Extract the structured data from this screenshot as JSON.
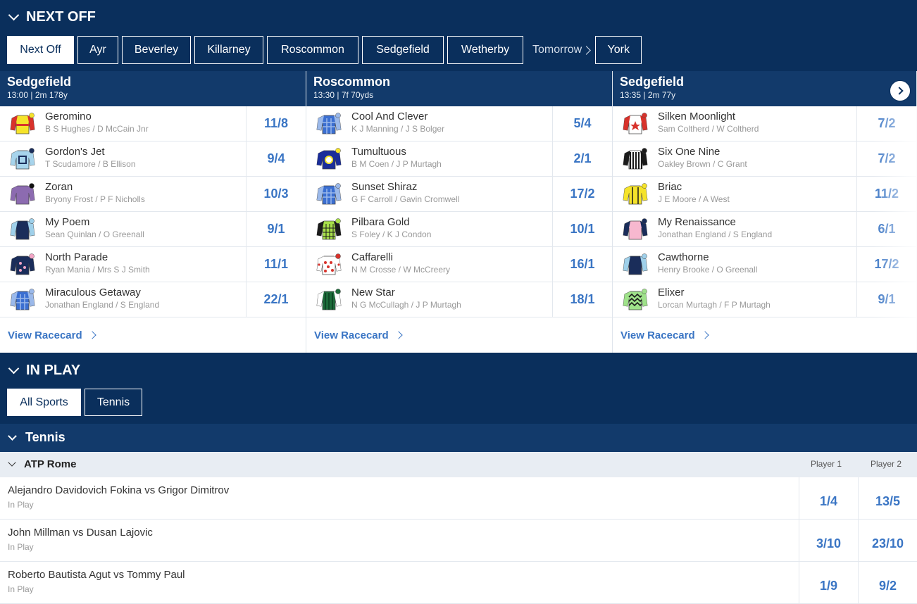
{
  "next_off": {
    "title": "NEXT OFF",
    "tabs": [
      "Next Off",
      "Ayr",
      "Beverley",
      "Killarney",
      "Roscommon",
      "Sedgefield",
      "Wetherby"
    ],
    "tomorrow_label": "Tomorrow",
    "tomorrow_tabs": [
      "York"
    ],
    "view_racecard_label": "View Racecard",
    "races": [
      {
        "course": "Sedgefield",
        "meta": "13:00 | 2m 178y",
        "runners": [
          {
            "name": "Geromino",
            "jockey": "B S Hughes / D McCain Jnr",
            "odds": "11/8",
            "silk": "yellow-red"
          },
          {
            "name": "Gordon's Jet",
            "jockey": "T Scudamore / B Ellison",
            "odds": "9/4",
            "silk": "lightblue-box"
          },
          {
            "name": "Zoran",
            "jockey": "Bryony Frost / P F Nicholls",
            "odds": "10/3",
            "silk": "purple"
          },
          {
            "name": "My Poem",
            "jockey": "Sean Quinlan / O Greenall",
            "odds": "9/1",
            "silk": "navy-lightblue"
          },
          {
            "name": "North Parade",
            "jockey": "Ryan Mania / Mrs S J Smith",
            "odds": "11/1",
            "silk": "navy-pink"
          },
          {
            "name": "Miraculous Getaway",
            "jockey": "Jonathan England / S England",
            "odds": "22/1",
            "silk": "blue-check"
          }
        ]
      },
      {
        "course": "Roscommon",
        "meta": "13:30 | 7f 70yds",
        "runners": [
          {
            "name": "Cool And Clever",
            "jockey": "K J Manning / J S Bolger",
            "odds": "5/4",
            "silk": "blue-check"
          },
          {
            "name": "Tumultuous",
            "jockey": "B M Coen / J P Murtagh",
            "odds": "2/1",
            "silk": "navy-yellow"
          },
          {
            "name": "Sunset Shiraz",
            "jockey": "G F Carroll / Gavin Cromwell",
            "odds": "17/2",
            "silk": "blue-check"
          },
          {
            "name": "Pilbara Gold",
            "jockey": "S Foley / K J Condon",
            "odds": "10/1",
            "silk": "green-check"
          },
          {
            "name": "Caffarelli",
            "jockey": "N M Crosse / W McCreery",
            "odds": "16/1",
            "silk": "red-spots"
          },
          {
            "name": "New Star",
            "jockey": "N G McCullagh / J P Murtagh",
            "odds": "18/1",
            "silk": "green-stripes"
          }
        ]
      },
      {
        "course": "Sedgefield",
        "meta": "13:35 | 2m 77y",
        "runners": [
          {
            "name": "Silken Moonlight",
            "jockey": "Sam Coltherd / W Coltherd",
            "odds": "7/2",
            "silk": "white-star"
          },
          {
            "name": "Six One Nine",
            "jockey": "Oakley Brown / C Grant",
            "odds": "7/2",
            "silk": "black-stripes"
          },
          {
            "name": "Briac",
            "jockey": "J E Moore / A West",
            "odds": "11/2",
            "silk": "yellow-stripes"
          },
          {
            "name": "My Renaissance",
            "jockey": "Jonathan England / S England",
            "odds": "6/1",
            "silk": "pink-navy"
          },
          {
            "name": "Cawthorne",
            "jockey": "Henry Brooke / O Greenall",
            "odds": "17/2",
            "silk": "navy-lightblue"
          },
          {
            "name": "Elixer",
            "jockey": "Lorcan Murtagh / F P Murtagh",
            "odds": "9/1",
            "silk": "green-diamond"
          }
        ]
      }
    ]
  },
  "in_play": {
    "title": "IN PLAY",
    "tabs": [
      "All Sports",
      "Tennis"
    ],
    "sport": "Tennis",
    "competition": "ATP Rome",
    "col_headers": [
      "Player 1",
      "Player 2"
    ],
    "matches": [
      {
        "name": "Alejandro Davidovich Fokina vs Grigor Dimitrov",
        "status": "In Play",
        "p1": "1/4",
        "p2": "13/5"
      },
      {
        "name": "John Millman vs Dusan Lajovic",
        "status": "In Play",
        "p1": "3/10",
        "p2": "23/10"
      },
      {
        "name": "Roberto Bautista Agut vs Tommy Paul",
        "status": "In Play",
        "p1": "1/9",
        "p2": "9/2"
      }
    ]
  },
  "colors": {
    "navy": "#0a2f5c",
    "header_blue": "#123a6b",
    "odds_blue": "#3a75c4"
  }
}
